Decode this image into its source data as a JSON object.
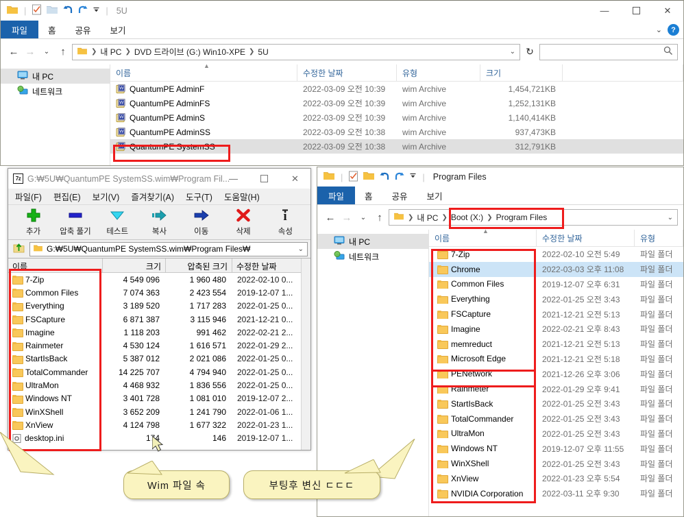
{
  "explorer1": {
    "quick_access": {
      "title": "5U",
      "icons": [
        "folder-icon",
        "properties-icon",
        "new-folder-icon",
        "undo-icon",
        "redo-icon",
        "customize-caret-icon"
      ]
    },
    "window_buttons": {
      "minimize": "—",
      "maximize": "☐",
      "close": "✕"
    },
    "ribbon_tabs": [
      {
        "label": "파일",
        "active": true
      },
      {
        "label": "홈",
        "active": false
      },
      {
        "label": "공유",
        "active": false
      },
      {
        "label": "보기",
        "active": false
      }
    ],
    "ribbon_right": {
      "collapse": "⌄",
      "help": "?"
    },
    "nav": {
      "back": "←",
      "forward": "→",
      "recent": "⌄",
      "up": "↑",
      "refresh": "↻"
    },
    "breadcrumb": [
      "내 PC",
      "DVD 드라이브 (G:) Win10-XPE",
      "5U"
    ],
    "breadcrumb_dropdown": "⌄",
    "search": {
      "placeholder": "",
      "value": "",
      "icon": "search-icon"
    },
    "nav_pane": [
      {
        "label": "내 PC",
        "icon": "this-pc-icon",
        "selected": true
      },
      {
        "label": "네트워크",
        "icon": "network-icon",
        "selected": false
      }
    ],
    "columns": [
      "이름",
      "수정한 날짜",
      "유형",
      "크기"
    ],
    "rows": [
      {
        "name": "QuantumPE AdminF",
        "date": "2022-03-09 오전 10:39",
        "type": "wim Archive",
        "size": "1,454,721KB",
        "selected": false
      },
      {
        "name": "QuantumPE AdminFS",
        "date": "2022-03-09 오전 10:39",
        "type": "wim Archive",
        "size": "1,252,131KB",
        "selected": false
      },
      {
        "name": "QuantumPE AdminS",
        "date": "2022-03-09 오전 10:39",
        "type": "wim Archive",
        "size": "1,140,414KB",
        "selected": false
      },
      {
        "name": "QuantumPE AdminSS",
        "date": "2022-03-09 오전 10:38",
        "type": "wim Archive",
        "size": "937,473KB",
        "selected": false
      },
      {
        "name": "QuantumPE SystemSS",
        "date": "2022-03-09 오전 10:38",
        "type": "wim Archive",
        "size": "312,791KB",
        "selected": true
      }
    ]
  },
  "sevenzip": {
    "title": "G:₩5U₩QuantumPE SystemSS.wim₩Program Fil...",
    "app_icon": "7z-icon",
    "window_buttons": {
      "minimize": "—",
      "maximize": "☐",
      "close": "✕"
    },
    "menu": [
      "파일(F)",
      "편집(E)",
      "보기(V)",
      "즐겨찾기(A)",
      "도구(T)",
      "도움말(H)"
    ],
    "toolbar": [
      {
        "label": "추가",
        "icon": "add-icon"
      },
      {
        "label": "압축 풀기",
        "icon": "extract-icon"
      },
      {
        "label": "테스트",
        "icon": "test-icon"
      },
      {
        "label": "복사",
        "icon": "copy-icon"
      },
      {
        "label": "이동",
        "icon": "move-icon"
      },
      {
        "label": "삭제",
        "icon": "delete-icon"
      },
      {
        "label": "속성",
        "icon": "info-icon"
      }
    ],
    "address": {
      "value": "G:₩5U₩QuantumPE SystemSS.wim₩Program Files₩",
      "up_icon": "up-folder-icon",
      "dropdown": "⌄"
    },
    "columns": [
      "이름",
      "크기",
      "압축된 크기",
      "수정한 날짜"
    ],
    "rows": [
      {
        "name": "7-Zip",
        "icon": "folder-icon",
        "size": "4 549 096",
        "packed": "1 960 480",
        "date": "2022-02-10 0..."
      },
      {
        "name": "Common Files",
        "icon": "folder-icon",
        "size": "7 074 363",
        "packed": "2 423 554",
        "date": "2019-12-07 1..."
      },
      {
        "name": "Everything",
        "icon": "folder-icon",
        "size": "3 189 520",
        "packed": "1 717 283",
        "date": "2022-01-25 0..."
      },
      {
        "name": "FSCapture",
        "icon": "folder-icon",
        "size": "6 871 387",
        "packed": "3 115 946",
        "date": "2021-12-21 0..."
      },
      {
        "name": "Imagine",
        "icon": "folder-icon",
        "size": "1 118 203",
        "packed": "991 462",
        "date": "2022-02-21 2..."
      },
      {
        "name": "Rainmeter",
        "icon": "folder-icon",
        "size": "4 530 124",
        "packed": "1 616 571",
        "date": "2022-01-29 2..."
      },
      {
        "name": "StartIsBack",
        "icon": "folder-icon",
        "size": "5 387 012",
        "packed": "2 021 086",
        "date": "2022-01-25 0..."
      },
      {
        "name": "TotalCommander",
        "icon": "folder-icon",
        "size": "14 225 707",
        "packed": "4 794 940",
        "date": "2022-01-25 0..."
      },
      {
        "name": "UltraMon",
        "icon": "folder-icon",
        "size": "4 468 932",
        "packed": "1 836 556",
        "date": "2022-01-25 0..."
      },
      {
        "name": "Windows NT",
        "icon": "folder-icon",
        "size": "3 401 728",
        "packed": "1 081 010",
        "date": "2019-12-07 2..."
      },
      {
        "name": "WinXShell",
        "icon": "folder-icon",
        "size": "3 652 209",
        "packed": "1 241 790",
        "date": "2022-01-06 1..."
      },
      {
        "name": "XnView",
        "icon": "folder-icon",
        "size": "4 124 798",
        "packed": "1 677 322",
        "date": "2022-01-23 1..."
      },
      {
        "name": "desktop.ini",
        "icon": "ini-file-icon",
        "size": "174",
        "packed": "146",
        "date": "2019-12-07 1..."
      }
    ]
  },
  "explorer2": {
    "quick_access": {
      "title": "Program Files",
      "icons": [
        "folder-icon",
        "properties-icon",
        "new-folder-icon",
        "undo-icon",
        "redo-icon",
        "customize-caret-icon"
      ]
    },
    "ribbon_tabs": [
      {
        "label": "파일",
        "active": true
      },
      {
        "label": "홈",
        "active": false
      },
      {
        "label": "공유",
        "active": false
      },
      {
        "label": "보기",
        "active": false
      }
    ],
    "nav": {
      "back": "←",
      "forward": "→",
      "recent": "⌄",
      "up": "↑"
    },
    "breadcrumb": [
      "내 PC",
      "Boot (X:)",
      "Program Files"
    ],
    "breadcrumb_dropdown": "⌄",
    "nav_pane": [
      {
        "label": "내 PC",
        "icon": "this-pc-icon",
        "selected": true
      },
      {
        "label": "네트워크",
        "icon": "network-icon",
        "selected": false
      }
    ],
    "columns": [
      "이름",
      "수정한 날짜",
      "유형"
    ],
    "rows": [
      {
        "name": "7-Zip",
        "date": "2022-02-10 오전 5:49",
        "type": "파일 폴더",
        "selected": false
      },
      {
        "name": "Chrome",
        "date": "2022-03-03 오후 11:08",
        "type": "파일 폴더",
        "selected": true
      },
      {
        "name": "Common Files",
        "date": "2019-12-07 오후 6:31",
        "type": "파일 폴더",
        "selected": false
      },
      {
        "name": "Everything",
        "date": "2022-01-25 오전 3:43",
        "type": "파일 폴더",
        "selected": false
      },
      {
        "name": "FSCapture",
        "date": "2021-12-21 오전 5:13",
        "type": "파일 폴더",
        "selected": false
      },
      {
        "name": "Imagine",
        "date": "2022-02-21 오후 8:43",
        "type": "파일 폴더",
        "selected": false
      },
      {
        "name": "memreduct",
        "date": "2021-12-21 오전 5:13",
        "type": "파일 폴더",
        "selected": false
      },
      {
        "name": "Microsoft Edge",
        "date": "2021-12-21 오전 5:18",
        "type": "파일 폴더",
        "selected": false
      },
      {
        "name": "PENetwork",
        "date": "2021-12-26 오후 3:06",
        "type": "파일 폴더",
        "selected": false
      },
      {
        "name": "Rainmeter",
        "date": "2022-01-29 오후 9:41",
        "type": "파일 폴더",
        "selected": false
      },
      {
        "name": "StartIsBack",
        "date": "2022-01-25 오전 3:43",
        "type": "파일 폴더",
        "selected": false
      },
      {
        "name": "TotalCommander",
        "date": "2022-01-25 오전 3:43",
        "type": "파일 폴더",
        "selected": false
      },
      {
        "name": "UltraMon",
        "date": "2022-01-25 오전 3:43",
        "type": "파일 폴더",
        "selected": false
      },
      {
        "name": "Windows NT",
        "date": "2019-12-07 오후 11:55",
        "type": "파일 폴더",
        "selected": false
      },
      {
        "name": "WinXShell",
        "date": "2022-01-25 오전 3:43",
        "type": "파일 폴더",
        "selected": false
      },
      {
        "name": "XnView",
        "date": "2022-01-23 오후 5:54",
        "type": "파일 폴더",
        "selected": false
      },
      {
        "name": "NVIDIA Corporation",
        "date": "2022-03-11 오후 9:30",
        "type": "파일 폴더",
        "selected": false
      }
    ]
  },
  "callouts": [
    {
      "text": "Wim 파일 속"
    },
    {
      "text": "부팅후 변신 ㄷㄷㄷ"
    }
  ],
  "colors": {
    "accent": "#1b62ab",
    "highlight_red": "#ee1c1c",
    "callout_fill": "#faf4c0",
    "selection_blue": "#cce4f7",
    "selection_gray": "#e0e0e0",
    "folder_yellow": "#f9c85a"
  }
}
